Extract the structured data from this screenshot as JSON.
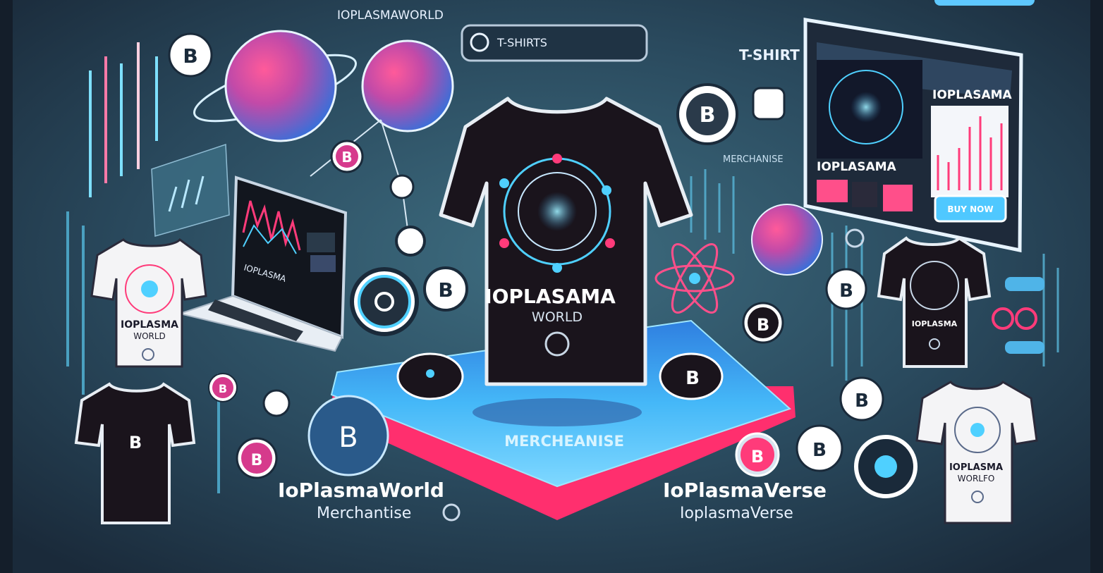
{
  "header": {
    "brand": "IOPLASMAWORLD",
    "search_text": "T-SHIRTS"
  },
  "labels": {
    "tshirt": "T-SHIRT",
    "merchandise_tag": "MERCHANISE",
    "center_brand_line1": "IOPLASAMA",
    "center_brand_line2": "WORLD",
    "platform_label": "MERCHEANISE",
    "left_brand": "IoPlasmaWorld",
    "left_sub": "Merchantise",
    "right_brand": "IoPlasmaVerse",
    "right_sub": "IoplasmaVerse",
    "laptop_screen": "IOPLASMA",
    "white_tee_text": "IOPLASMA",
    "white_tee_text2": "WORLD",
    "right_tee_text": "IOPLASMA",
    "right_white_tee_text": "IOPLASMA",
    "right_white_tee_text2": "WORLFO"
  },
  "storefront": {
    "title": "IOPLASAMA",
    "subtitle": "IOPLASAMA",
    "button_label": "BUY NOW"
  },
  "coins": {
    "symbol": "B"
  },
  "colors": {
    "bg_dark": "#1a2330",
    "bg_teal": "#2f5c70",
    "accent_pink": "#ff2f7a",
    "accent_cyan": "#4fd0ff",
    "accent_blue": "#3a8cff"
  }
}
